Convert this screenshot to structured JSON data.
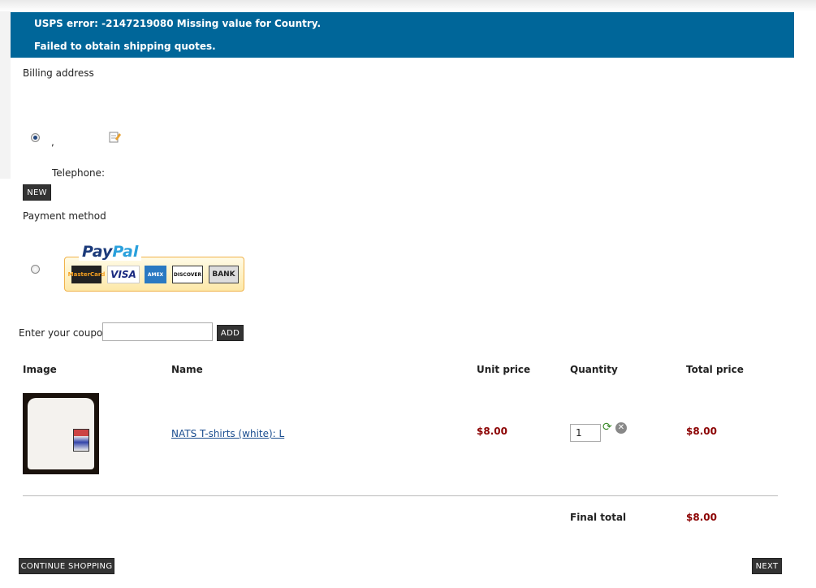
{
  "error": {
    "line1": "USPS error: -2147219080 Missing value for Country.",
    "line2": "Failed to obtain shipping quotes."
  },
  "billing": {
    "heading": "Billing address",
    "address_comma": ",",
    "telephone_label": "Telephone:",
    "new_button": "NEW"
  },
  "payment": {
    "heading": "Payment method",
    "paypal_word1": "Pay",
    "paypal_word2": "Pal",
    "cards": [
      "MasterCard",
      "VISA",
      "AMEX",
      "DISCOVER",
      "BANK"
    ]
  },
  "coupon": {
    "label": "Enter your coupon",
    "value": "",
    "add_button": "ADD"
  },
  "table": {
    "headers": [
      "Image",
      "Name",
      "Unit price",
      "Quantity",
      "Total price"
    ],
    "rows": [
      {
        "name": "NATS T-shirts (white): L",
        "unit_price": "$8.00",
        "quantity": "1",
        "total": "$8.00"
      }
    ],
    "final_label": "Final total",
    "final_value": "$8.00"
  },
  "footer": {
    "continue_button": "CONTINUE SHOPPING",
    "next_button": "NEXT"
  },
  "colors": {
    "error_bg": "#006699",
    "price": "#8b0000",
    "button_bg": "#333333"
  }
}
